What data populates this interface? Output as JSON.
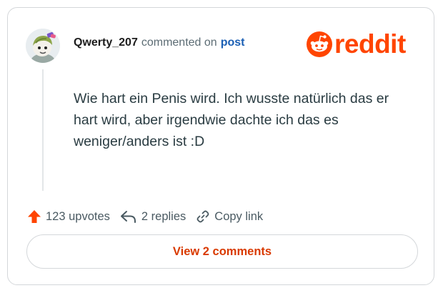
{
  "comment": {
    "username": "Qwerty_207",
    "commented_on_text": "commented on",
    "post_link": "post",
    "body": "Wie hart ein Penis wird. Ich wusste natürlich das er hart wird, aber irgendwie dachte ich das es weniger/anders ist :D"
  },
  "brand": {
    "wordmark": "reddit",
    "color": "#ff4500"
  },
  "actions": {
    "upvotes": "123 upvotes",
    "replies": "2 replies",
    "copy_link": "Copy link"
  },
  "footer": {
    "view_comments": "View 2 comments"
  },
  "icons": {
    "upvote": "upvote-arrow-icon",
    "reply": "reply-arrow-icon",
    "link": "chain-link-icon",
    "logo": "reddit-snoo-icon"
  },
  "colors": {
    "upvote": "#ff4500",
    "link_blue": "#1a5fb4",
    "cta_orange": "#d93a00"
  }
}
